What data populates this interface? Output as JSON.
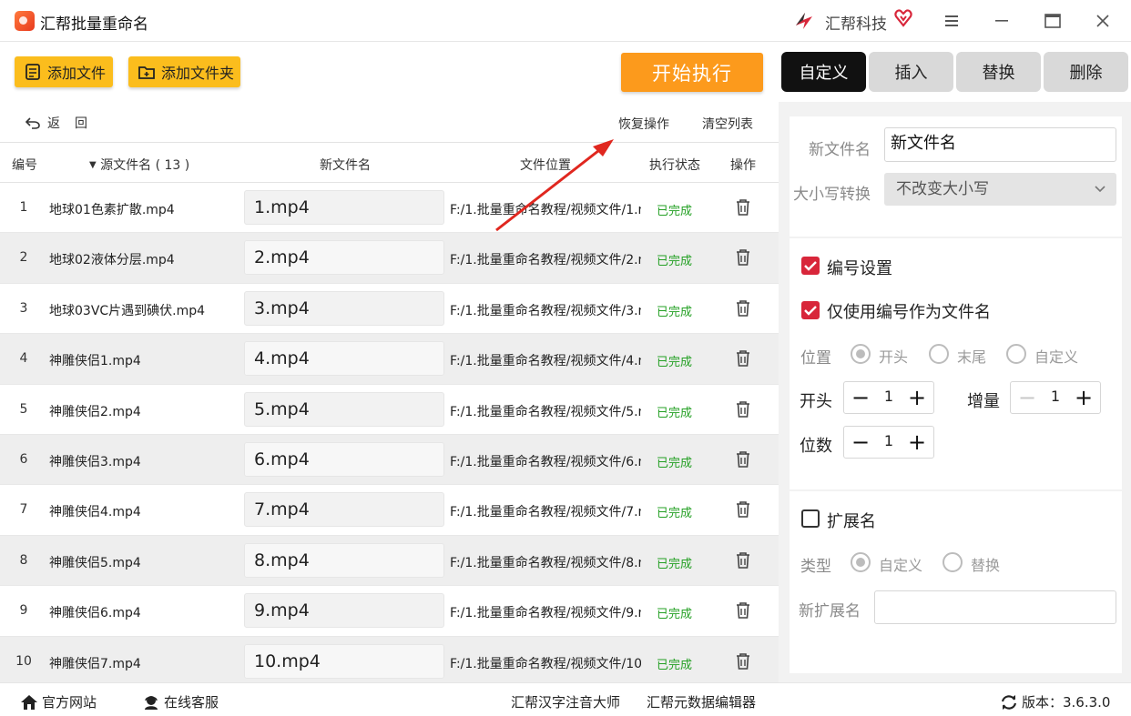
{
  "window": {
    "title": "汇帮批量重命名",
    "brand": "汇帮科技"
  },
  "toolbar": {
    "add_file": "添加文件",
    "add_folder": "添加文件夹",
    "start": "开始执行",
    "tabs": [
      "自定义",
      "插入",
      "替换",
      "删除"
    ],
    "active_tab": "自定义"
  },
  "actions": {
    "back": "返回",
    "restore": "恢复操作",
    "clear": "清空列表"
  },
  "table": {
    "headers": {
      "num": "编号",
      "source": "源文件名 ( 13 )",
      "new": "新文件名",
      "path": "文件位置",
      "status": "执行状态",
      "op": "操作"
    },
    "rows": [
      {
        "num": "1",
        "source": "地球01色素扩散.mp4",
        "new": "1.mp4",
        "path": "F:/1.批量重命名教程/视频文件/1.m",
        "status": "已完成"
      },
      {
        "num": "2",
        "source": "地球02液体分层.mp4",
        "new": "2.mp4",
        "path": "F:/1.批量重命名教程/视频文件/2.m",
        "status": "已完成"
      },
      {
        "num": "3",
        "source": "地球03VC片遇到碘伏.mp4",
        "new": "3.mp4",
        "path": "F:/1.批量重命名教程/视频文件/3.m",
        "status": "已完成"
      },
      {
        "num": "4",
        "source": "神雕侠侣1.mp4",
        "new": "4.mp4",
        "path": "F:/1.批量重命名教程/视频文件/4.m",
        "status": "已完成"
      },
      {
        "num": "5",
        "source": "神雕侠侣2.mp4",
        "new": "5.mp4",
        "path": "F:/1.批量重命名教程/视频文件/5.m",
        "status": "已完成"
      },
      {
        "num": "6",
        "source": "神雕侠侣3.mp4",
        "new": "6.mp4",
        "path": "F:/1.批量重命名教程/视频文件/6.m",
        "status": "已完成"
      },
      {
        "num": "7",
        "source": "神雕侠侣4.mp4",
        "new": "7.mp4",
        "path": "F:/1.批量重命名教程/视频文件/7.m",
        "status": "已完成"
      },
      {
        "num": "8",
        "source": "神雕侠侣5.mp4",
        "new": "8.mp4",
        "path": "F:/1.批量重命名教程/视频文件/8.m",
        "status": "已完成"
      },
      {
        "num": "9",
        "source": "神雕侠侣6.mp4",
        "new": "9.mp4",
        "path": "F:/1.批量重命名教程/视频文件/9.m",
        "status": "已完成"
      },
      {
        "num": "10",
        "source": "神雕侠侣7.mp4",
        "new": "10.mp4",
        "path": "F:/1.批量重命名教程/视频文件/10.r",
        "status": "已完成"
      }
    ]
  },
  "panel": {
    "new_name_label": "新文件名",
    "new_name_value": "新文件名",
    "case_label": "大小写转换",
    "case_value": "不改变大小写",
    "numbering_label": "编号设置",
    "numbering_checked": true,
    "only_number_label": "仅使用编号作为文件名",
    "only_number_checked": true,
    "position_label": "位置",
    "position_options": [
      "开头",
      "末尾",
      "自定义"
    ],
    "position_selected": "开头",
    "start_label": "开头",
    "start_value": "1",
    "increment_label": "增量",
    "increment_value": "1",
    "digits_label": "位数",
    "digits_value": "1",
    "ext_label": "扩展名",
    "ext_checked": false,
    "type_label": "类型",
    "type_options": [
      "自定义",
      "替换"
    ],
    "type_selected": "自定义",
    "new_ext_label": "新扩展名",
    "new_ext_value": ""
  },
  "bottom": {
    "website": "官方网站",
    "support": "在线客服",
    "app1": "汇帮汉字注音大师",
    "app2": "汇帮元数据编辑器",
    "version": "版本：3.6.3.0"
  },
  "colors": {
    "accent_orange": "#fc9a1c",
    "button_yellow": "#fbbd1d",
    "status_green": "#24a024",
    "checkbox_red": "#d8263a",
    "annotation_arrow": "#e0271f"
  }
}
